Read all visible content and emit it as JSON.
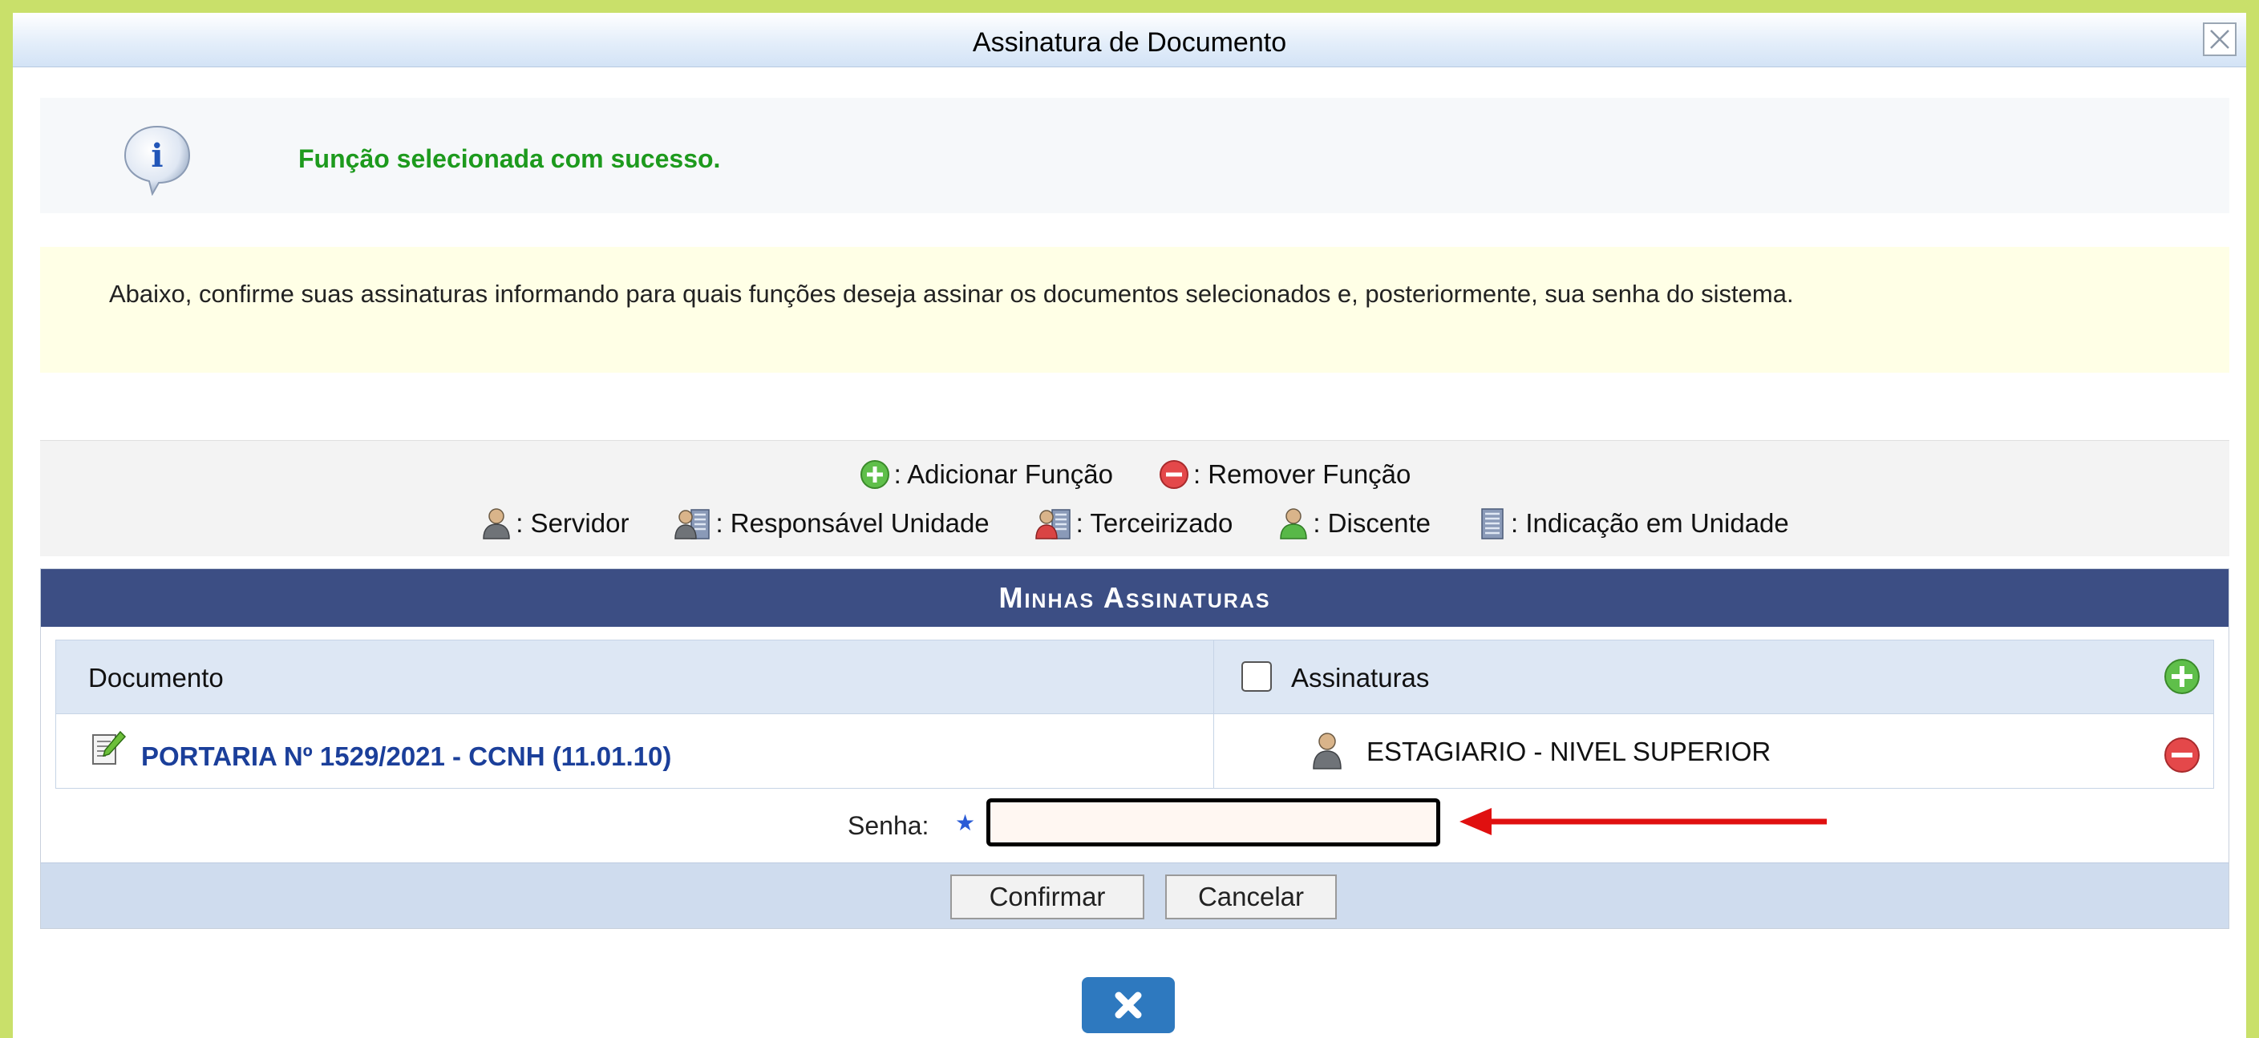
{
  "dialog": {
    "title": "Assinatura de Documento"
  },
  "info": {
    "message": "Função selecionada com sucesso.",
    "icon": "info-bubble-icon"
  },
  "instructions": "Abaixo, confirme suas assinaturas informando para quais funções deseja assinar os documentos selecionados e, posteriormente, sua senha do sistema.",
  "legend": {
    "row1": [
      {
        "icon": "add-circle-icon",
        "label": ": Adicionar Função"
      },
      {
        "icon": "remove-circle-icon",
        "label": ": Remover Função"
      }
    ],
    "row2": [
      {
        "icon": "servidor-icon",
        "label": ": Servidor"
      },
      {
        "icon": "responsavel-unidade-icon",
        "label": ": Responsável Unidade"
      },
      {
        "icon": "terceirizado-icon",
        "label": ": Terceirizado"
      },
      {
        "icon": "discente-icon",
        "label": ": Discente"
      },
      {
        "icon": "indicacao-unidade-icon",
        "label": ": Indicação em Unidade"
      }
    ]
  },
  "panel": {
    "title": "Minhas Assinaturas",
    "columns": {
      "document": "Documento",
      "signatures": "Assinaturas"
    },
    "rows": [
      {
        "document": "PORTARIA Nº 1529/2021 - CCNH (11.01.10)",
        "signature": "ESTAGIARIO - NIVEL SUPERIOR"
      }
    ],
    "password": {
      "label": "Senha:",
      "required_mark": "★",
      "value": ""
    },
    "buttons": {
      "confirm": "Confirmar",
      "cancel": "Cancelar"
    }
  },
  "colors": {
    "background": "#c9e06a",
    "header_bg": "#3c4e84",
    "success_text": "#1d9a1d",
    "link": "#1b3f9a",
    "arrow": "#e01010",
    "close_button": "#2e79bf"
  }
}
